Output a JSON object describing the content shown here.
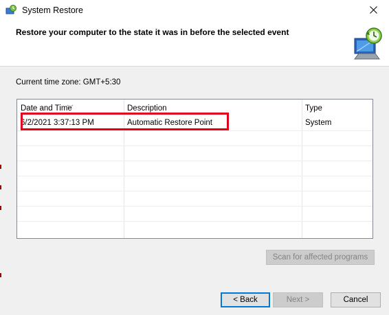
{
  "window": {
    "title": "System Restore"
  },
  "header": {
    "heading": "Restore your computer to the state it was in before the selected event"
  },
  "timezone": {
    "label": "Current time zone: GMT+5:30"
  },
  "table": {
    "columns": [
      "Date and Time",
      "Description",
      "Type"
    ],
    "rows": [
      {
        "date_time": "6/2/2021 3:37:13 PM",
        "description": "Automatic Restore Point",
        "type": "System"
      }
    ]
  },
  "buttons": {
    "scan": "Scan for affected programs",
    "back": "< Back",
    "next": "Next >",
    "cancel": "Cancel"
  },
  "colors": {
    "highlight": "#e0001b",
    "focus": "#0078d7"
  }
}
